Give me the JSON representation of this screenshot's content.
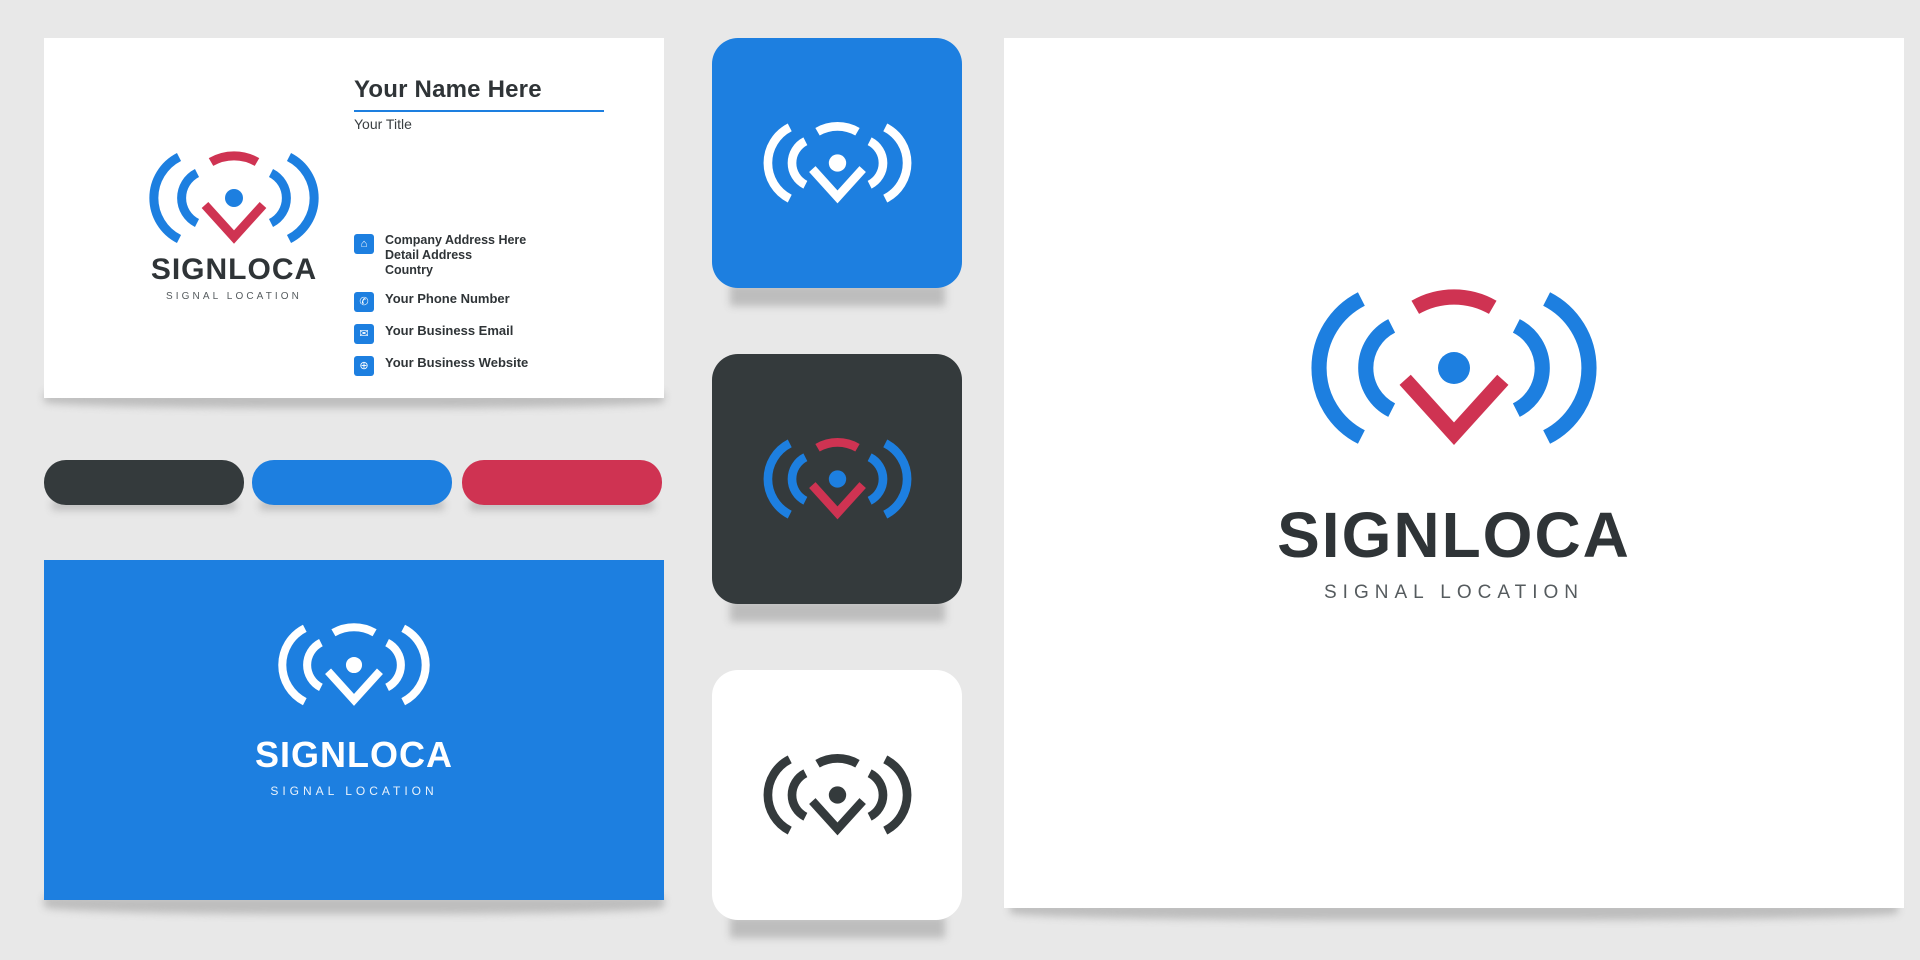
{
  "brand": {
    "name": "SIGNLOCA",
    "tagline": "SIGNAL LOCATION",
    "colors": {
      "blue": "#1d7fe0",
      "red": "#cf3352",
      "dark": "#343a3c",
      "white": "#ffffff",
      "background": "#e8e8e8"
    }
  },
  "business_card": {
    "name": "Your Name Here",
    "title": "Your Title",
    "contacts": [
      {
        "icon": "home-icon",
        "glyph": "⌂",
        "color": "blue",
        "lines": [
          "Company Address Here",
          "Detail Address",
          "Country"
        ]
      },
      {
        "icon": "phone-icon",
        "glyph": "✆",
        "color": "blue",
        "lines": [
          "Your  Phone Number"
        ]
      },
      {
        "icon": "email-icon",
        "glyph": "✉",
        "color": "blue",
        "lines": [
          "Your Business Email"
        ]
      },
      {
        "icon": "globe-icon",
        "glyph": "⊕",
        "color": "blue",
        "lines": [
          "Your Business Website"
        ]
      }
    ]
  },
  "swatches": [
    {
      "name": "dark-swatch",
      "color": "#343a3c"
    },
    {
      "name": "blue-swatch",
      "color": "#1d7fe0"
    },
    {
      "name": "red-swatch",
      "color": "#cf3352"
    }
  ],
  "app_icons": [
    {
      "name": "app-icon-blue",
      "background": "#1d7fe0",
      "mark": "white-mark"
    },
    {
      "name": "app-icon-dark",
      "background": "#343a3c",
      "mark": "blue-red-mark"
    },
    {
      "name": "app-icon-white",
      "background": "#ffffff",
      "mark": "dark-mark"
    }
  ],
  "presentation_panel": {
    "mark": "blue-red-mark",
    "wordmark": "SIGNLOCA",
    "submark": "SIGNAL LOCATION"
  }
}
